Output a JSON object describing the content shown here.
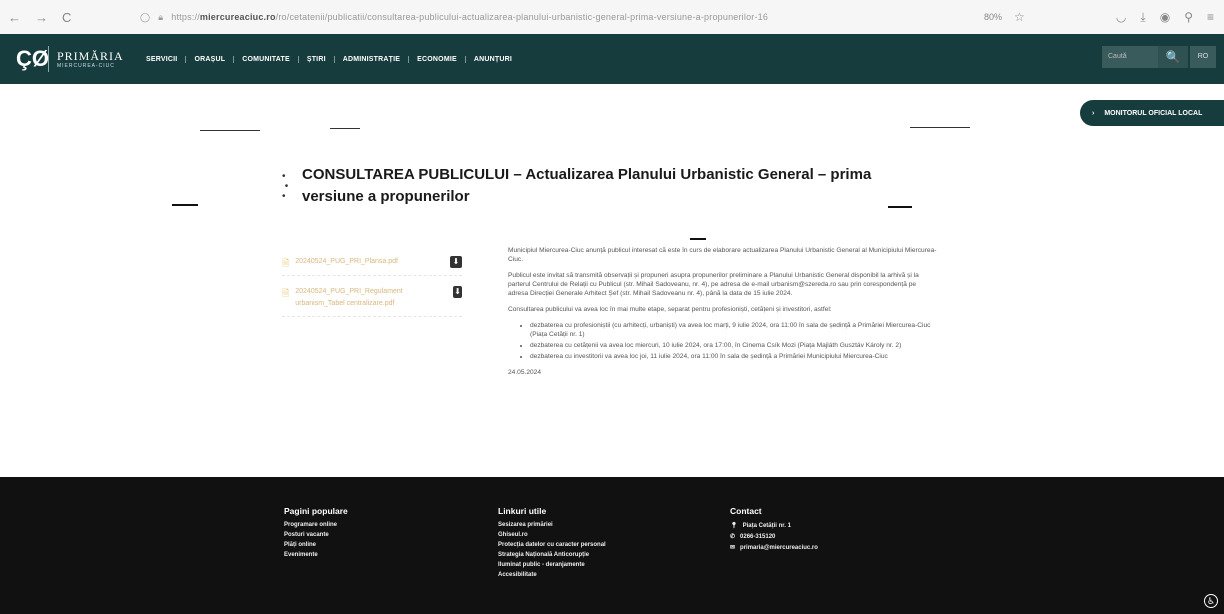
{
  "browser": {
    "back": "←",
    "forward": "→",
    "reload": "C",
    "url_prefix": "https://",
    "url_host": "miercureaciuc.ro",
    "url_path": "/ro/cetatenii/publicatii/consultarea-publicului-actualizarea-planului-urbanistic-general-prima-versiune-a-propunerilor-16",
    "zoom": "80%"
  },
  "site": {
    "logo_mark": "ÇØ",
    "logo_name": "PRIMĂRIA",
    "logo_sub": "MIERCUREA-CIUC",
    "menu": [
      "SERVICII",
      "ORAȘUL",
      "COMUNITATE",
      "ȘTIRI",
      "ADMINISTRAȚIE",
      "ECONOMIE",
      "ANUNȚURI"
    ],
    "search_placeholder": "Caută",
    "search_icon": "🔍",
    "lang": "RO",
    "monitor_label": "MONITORUL OFICIAL LOCAL"
  },
  "main": {
    "title": "CONSULTAREA PUBLICULUI – Actualizarea Planului Urbanistic General – prima versiune a propunerilor",
    "files": [
      {
        "name": "20240524_PUG_PRI_Plansa.pdf"
      },
      {
        "name": "20240524_PUG_PRI_Regulament urbanism_Tabel centralizare.pdf"
      }
    ],
    "paragraph1": "Municipiul Miercurea-Ciuc anunță publicul interesat că este în curs de elaborare actualizarea Planului Urbanistic General al Municipiului Miercurea-Ciuc.",
    "paragraph2": "Publicul este invitat să transmită observații și propuneri asupra propunerilor preliminare a Planului Urbanistic General disponibil la arhivă și la parterul Centrului de Relații cu Publicul (str. Mihail Sadoveanu, nr. 4), pe adresa de e-mail urbanism@szereda.ro sau prin corespondență pe adresa Direcției Generale Arhitect Șef (str. Mihail Sadoveanu nr. 4), până la data de 15 iulie 2024.",
    "paragraph3": "Consultarea publicului va avea loc în mai multe etape, separat pentru profesioniști, cetățeni și investitori, astfel:",
    "items": [
      "dezbaterea cu profesioniștii (cu arhitecți, urbaniști) va avea loc marți, 9 iulie 2024, ora 11:00 în sala de ședință a Primăriei Miercurea-Ciuc (Piața Cetății nr. 1)",
      "dezbaterea cu cetățenii va avea loc miercuri, 10 iulie 2024, ora 17:00, în Cinema Csík Mozi (Piața Majláth Gusztáv Károly nr. 2)",
      "dezbaterea cu investitorii va avea loc joi, 11 iulie 2024, ora 11:00 în sala de ședință a Primăriei Municipiului Miercurea-Ciuc"
    ],
    "date": "24.05.2024"
  },
  "footer": {
    "col1_title": "Pagini populare",
    "col1_links": [
      "Programare online",
      "Posturi vacante",
      "Plăți online",
      "Evenimente"
    ],
    "col2_title": "Linkuri utile",
    "col2_links": [
      "Sesizarea primăriei",
      "Ghiseul.ro",
      "Protecția datelor cu caracter personal",
      "Strategia Națională Anticorupție",
      "Iluminat public - deranjamente",
      "Accesibilitate"
    ],
    "col3_title": "Contact",
    "address": "Piața Cetății nr. 1",
    "phone": "0266-315120",
    "email": "primaria@miercureaciuc.ro"
  },
  "colors": {
    "header": "#173c3d",
    "footer": "#111111",
    "file_link": "#d8b77d"
  }
}
